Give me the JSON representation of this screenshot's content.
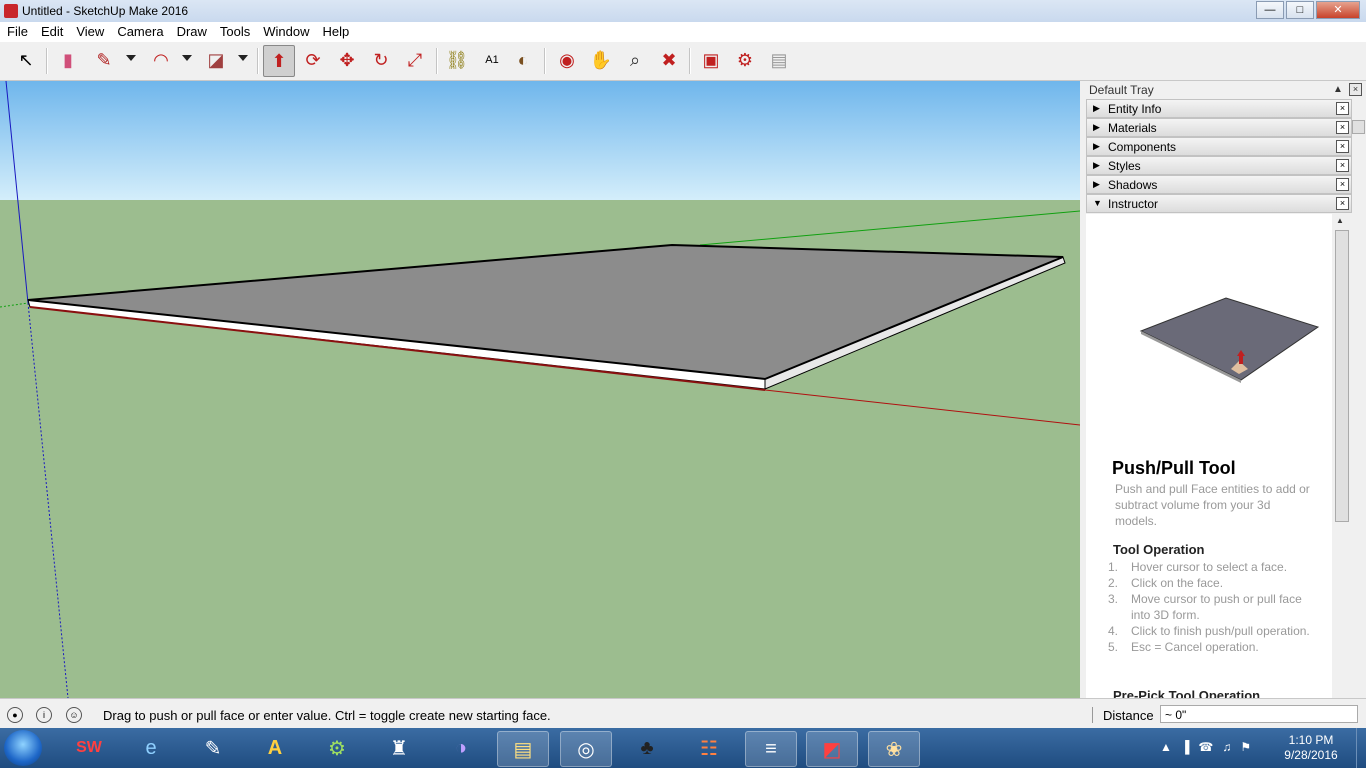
{
  "window": {
    "title": "Untitled - SketchUp Make 2016",
    "min": "—",
    "max": "□",
    "close": "✕"
  },
  "menu": [
    "File",
    "Edit",
    "View",
    "Camera",
    "Draw",
    "Tools",
    "Window",
    "Help"
  ],
  "toolbar": {
    "icons": {
      "select": "↖",
      "eraser": "▮",
      "pencil": "✎",
      "arc": "◠",
      "rectangle": "◪",
      "pushpull": "⬆",
      "followme": "⟳",
      "move": "✥",
      "rotate": "↻",
      "scale": "⤢",
      "tape": "⛓",
      "text": "A1",
      "paint": "◐",
      "orbit": "◉",
      "pan": "✋",
      "zoom": "⌕",
      "zoomext": "✖",
      "warehouse": "▣",
      "extension": "⚙",
      "share": "▤"
    }
  },
  "tray": {
    "title": "Default Tray",
    "pin": "▲",
    "close": "×",
    "panels": [
      {
        "label": "Entity Info",
        "collapsed": true
      },
      {
        "label": "Materials",
        "collapsed": true
      },
      {
        "label": "Components",
        "collapsed": true
      },
      {
        "label": "Styles",
        "collapsed": true
      },
      {
        "label": "Shadows",
        "collapsed": true
      },
      {
        "label": "Instructor",
        "collapsed": false
      }
    ],
    "collapsed_glyph": "▶",
    "expanded_glyph": "▼",
    "panel_close": "×"
  },
  "instructor": {
    "title": "Push/Pull Tool",
    "description": "Push and pull Face entities to add or subtract volume from your 3d models.",
    "tool_operation_heading": "Tool Operation",
    "steps": [
      "Hover cursor to select a face.",
      "Click on the face.",
      "Move cursor to push or pull face into 3D form.",
      "Click to finish push/pull operation.",
      "Esc = Cancel operation."
    ],
    "prepick_heading": "Pre-Pick Tool Operation"
  },
  "status": {
    "message": "Drag to push or pull face or enter value.  Ctrl = toggle create new starting face.",
    "measure_label": "Distance",
    "measure_value": "~ 0\""
  },
  "taskbar": {
    "apps": [
      {
        "name": "solidworks",
        "icon": "SW"
      },
      {
        "name": "ie",
        "icon": "e"
      },
      {
        "name": "notepad",
        "icon": "✎"
      },
      {
        "name": "autocad",
        "icon": "A"
      },
      {
        "name": "android",
        "icon": "⚙"
      },
      {
        "name": "game",
        "icon": "♜"
      },
      {
        "name": "eclipse",
        "icon": "◑"
      },
      {
        "name": "explorer",
        "icon": "▤"
      },
      {
        "name": "chrome",
        "icon": "◎"
      },
      {
        "name": "inkscape",
        "icon": "♣"
      },
      {
        "name": "apps",
        "icon": "☷"
      },
      {
        "name": "notes",
        "icon": "≡"
      },
      {
        "name": "sketchup",
        "icon": "◩"
      },
      {
        "name": "paint",
        "icon": "❀"
      }
    ],
    "tray_icons": [
      "▲",
      "▐",
      "☎",
      "♫",
      "⚑"
    ],
    "time": "1:10 PM",
    "date": "9/28/2016"
  },
  "colors": {
    "sky": "#8ec8f2",
    "ground": "#9cbd8f",
    "face": "#8c8c8c",
    "accent": "#c8262c"
  }
}
